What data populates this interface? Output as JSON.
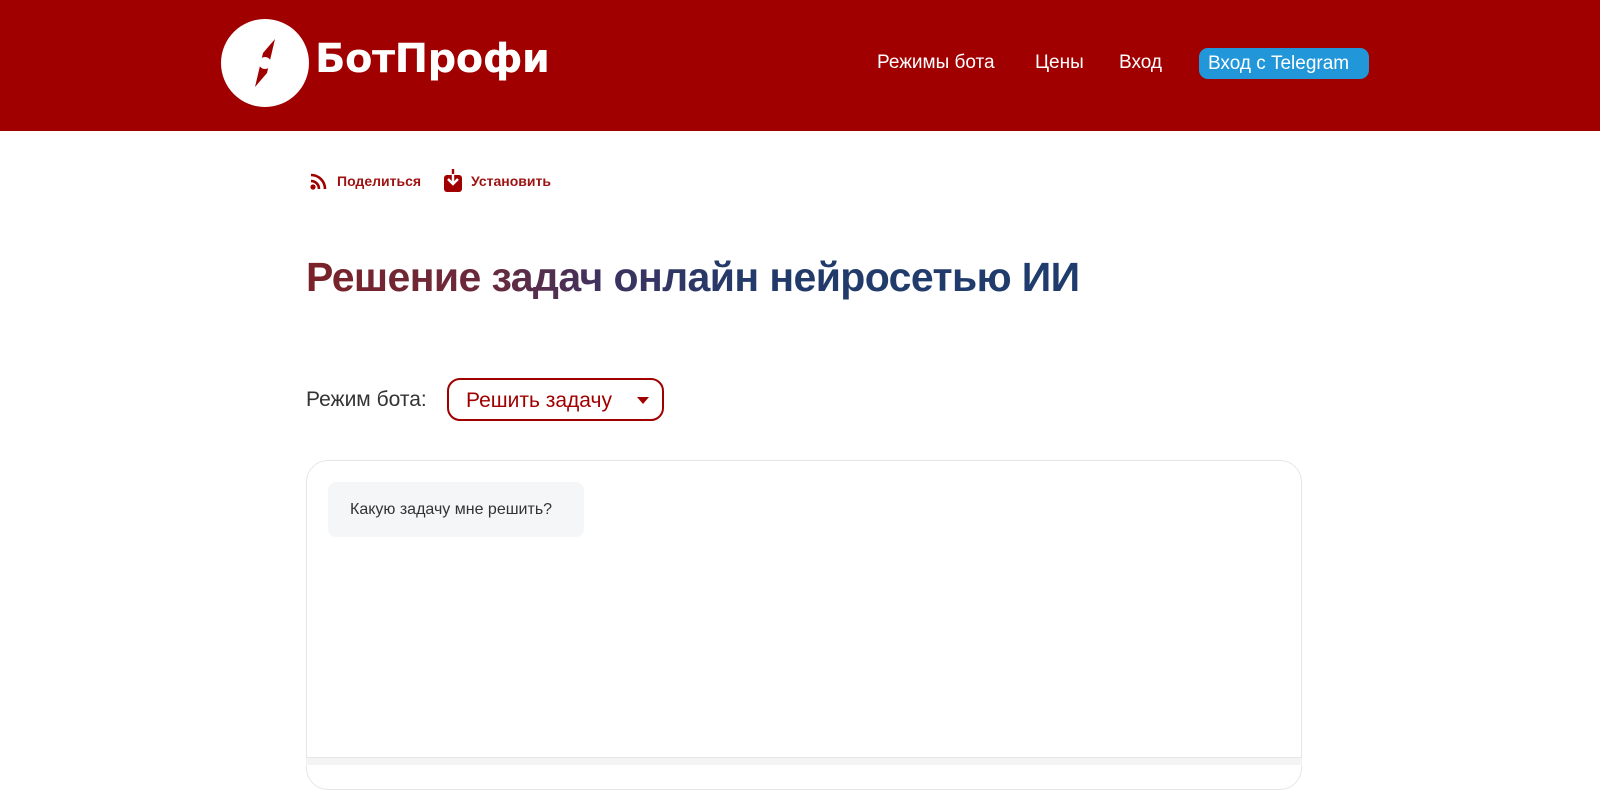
{
  "header": {
    "brand": "БотПрофи",
    "logo_icon": "compass-needle-icon",
    "nav": {
      "modes": "Режимы бота",
      "prices": "Цены",
      "login": "Вход",
      "telegram": "m    Вход с Telegram"
    }
  },
  "actions": {
    "share": {
      "label": "Поделиться",
      "icon": "share-signal-icon"
    },
    "install": {
      "label": "Установить",
      "icon": "download-icon"
    }
  },
  "page": {
    "title": "Решение задач онлайн нейросетью ИИ"
  },
  "mode": {
    "label": "Режим бота:",
    "selected": "Решить задачу"
  },
  "chat": {
    "bot_message": "Какую задачу мне решить?"
  },
  "colors": {
    "header_bg": "#a00000",
    "telegram_button": "#2196d9",
    "accent": "#a00000",
    "title_start": "#7a2228",
    "title_end": "#1f3c6c"
  }
}
